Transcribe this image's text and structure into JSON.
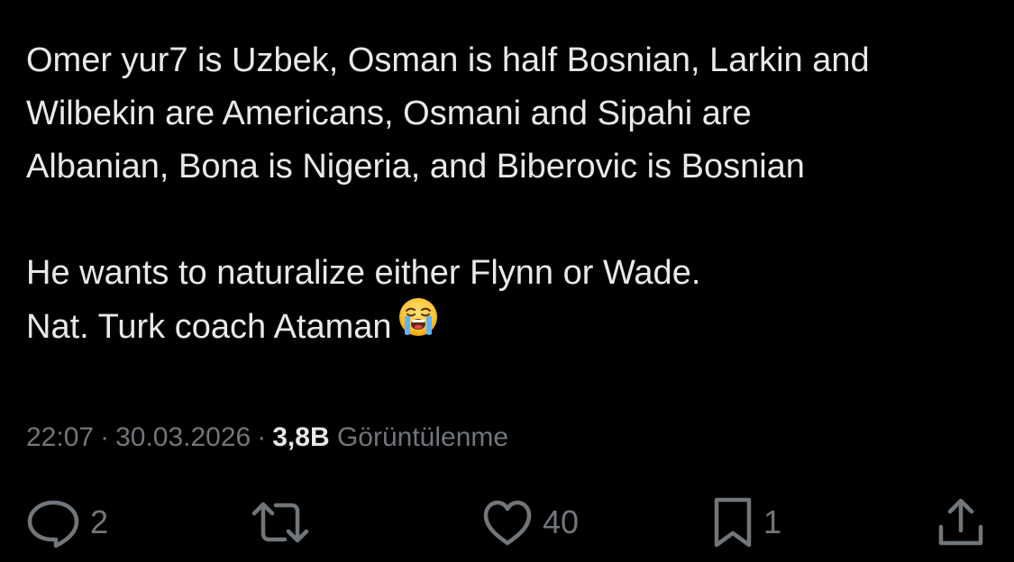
{
  "tweet": {
    "paragraph1": {
      "line1": "Omer yur7 is Uzbek, Osman is half Bosnian, Larkin and",
      "line2": "Wilbekin are Americans, Osmani and Sipahi are",
      "line3": "Albanian, Bona is Nigeria, and Biberovic is Bosnian"
    },
    "paragraph2": {
      "line1": "He wants to naturalize either Flynn or Wade.",
      "line2": "Nat. Turk coach Ataman"
    },
    "emoji": "loudly-crying-face-emoji"
  },
  "meta": {
    "time": "22:07",
    "separator": "·",
    "date": "30.03.2026",
    "views_count": "3,8B",
    "views_label": "Görüntülenme"
  },
  "actions": {
    "reply_count": "2",
    "retweet_count": "",
    "like_count": "40",
    "bookmark_count": "1"
  },
  "icons": {
    "reply": "reply-icon",
    "retweet": "retweet-icon",
    "like": "heart-icon",
    "bookmark": "bookmark-icon",
    "share": "share-icon"
  },
  "colors": {
    "background": "#000000",
    "text": "#e7e9ea",
    "secondary": "#71767b"
  }
}
